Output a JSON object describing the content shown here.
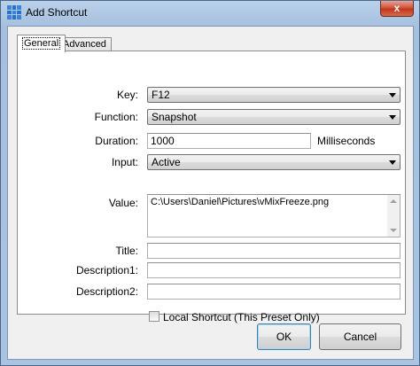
{
  "window": {
    "title": "Add Shortcut",
    "close_glyph": "x"
  },
  "tabs": [
    {
      "label": "General",
      "active": true
    },
    {
      "label": "Advanced",
      "active": false
    }
  ],
  "form": {
    "key": {
      "label": "Key:",
      "value": "F12"
    },
    "function": {
      "label": "Function:",
      "value": "Snapshot"
    },
    "duration": {
      "label": "Duration:",
      "value": "1000",
      "unit": "Milliseconds"
    },
    "input": {
      "label": "Input:",
      "value": "Active"
    },
    "value": {
      "label": "Value:",
      "value": "C:\\Users\\Daniel\\Pictures\\vMixFreeze.png"
    },
    "title": {
      "label": "Title:",
      "value": ""
    },
    "description1": {
      "label": "Description1:",
      "value": ""
    },
    "description2": {
      "label": "Description2:",
      "value": ""
    },
    "local_shortcut": {
      "label": "Local Shortcut (This Preset Only)",
      "checked": false
    }
  },
  "buttons": {
    "ok": "OK",
    "cancel": "Cancel"
  }
}
